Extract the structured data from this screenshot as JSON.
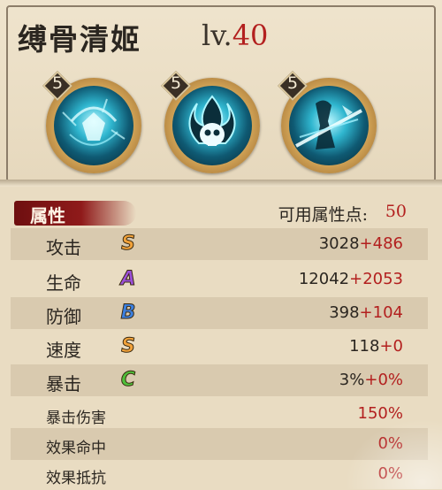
{
  "hero": {
    "name": "缚骨清姬",
    "level_prefix": "lv.",
    "level": "40"
  },
  "skills": [
    {
      "level": "5",
      "icon": "shield-orb-icon"
    },
    {
      "level": "5",
      "icon": "skull-flame-icon"
    },
    {
      "level": "5",
      "icon": "ghost-slash-icon"
    }
  ],
  "attributes_tab": "属性",
  "available_points_label": "可用属性点:",
  "available_points": "50",
  "stats": [
    {
      "name": "攻击",
      "grade": "S",
      "grade_color": "#f2a23a",
      "base": "3028",
      "bonus": "+486"
    },
    {
      "name": "生命",
      "grade": "A",
      "grade_color": "#9b4fd8",
      "base": "12042",
      "bonus": "+2053"
    },
    {
      "name": "防御",
      "grade": "B",
      "grade_color": "#3a7fe0",
      "base": "398",
      "bonus": "+104"
    },
    {
      "name": "速度",
      "grade": "S",
      "grade_color": "#f2a23a",
      "base": "118",
      "bonus": "+0"
    },
    {
      "name": "暴击",
      "grade": "C",
      "grade_color": "#4fbf3a",
      "base": "3%",
      "bonus": "+0%"
    }
  ],
  "extra_stats": [
    {
      "name": "暴击伤害",
      "value": "150%"
    },
    {
      "name": "效果命中",
      "value": "0%"
    },
    {
      "name": "效果抵抗",
      "value": "0%"
    }
  ]
}
